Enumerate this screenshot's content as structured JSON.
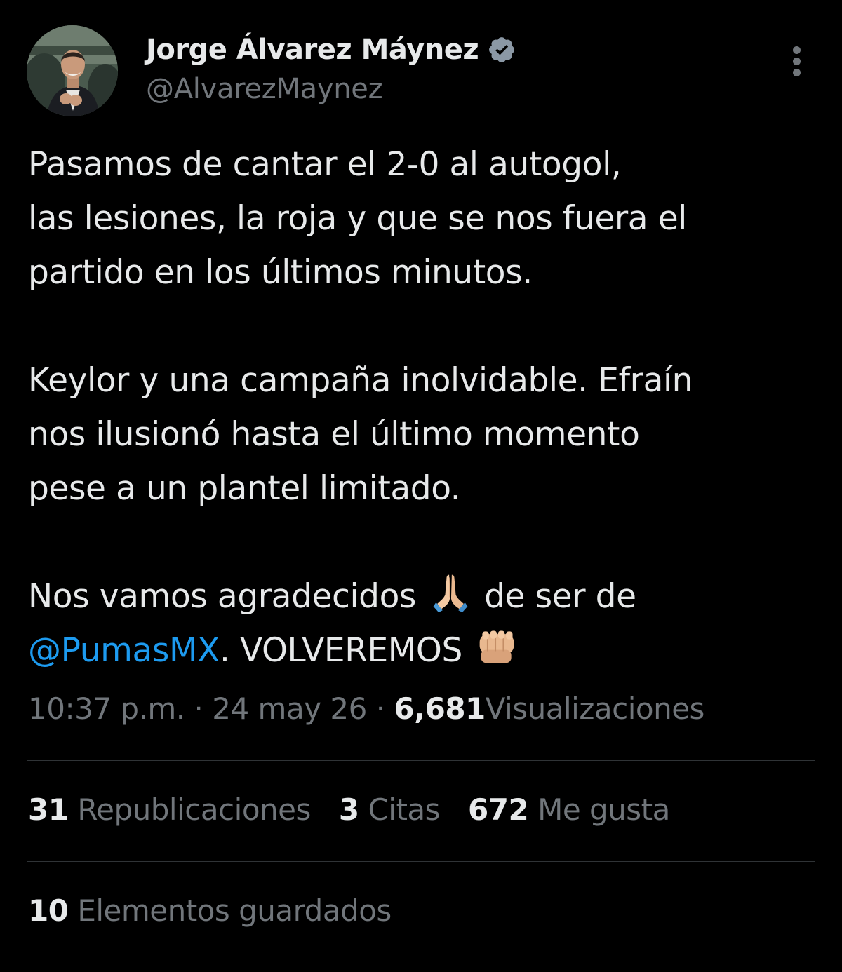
{
  "author": {
    "display_name": "Jorge Álvarez Máynez",
    "handle": "@AlvarezMaynez",
    "verified": true,
    "avatar_icon": "profile-photo"
  },
  "tweet": {
    "lines_p1": [
      "Pasamos de cantar el 2-0 al autogol,",
      "las lesiones, la roja y que se nos fuera el",
      "partido en los últimos minutos."
    ],
    "lines_p2": [
      "Keylor y una campaña inolvidable. Efraín",
      "nos ilusionó hasta el último momento",
      "pese a un plantel limitado."
    ],
    "p3_part1": "Nos vamos agradecidos",
    "p3_part2": "de ser de",
    "mention": "@PumasMX",
    "p3_part3": ". VOLVEREMOS",
    "emoji_1": "folded-hands-icon",
    "emoji_2": "fist-icon"
  },
  "meta": {
    "time": "10:37 p.m.",
    "sep": "·",
    "date": "24 may 26",
    "views_count": "6,681",
    "views_label": "Visualizaciones"
  },
  "stats": {
    "reposts_count": "31",
    "reposts_label": "Republicaciones",
    "quotes_count": "3",
    "quotes_label": "Citas",
    "likes_count": "672",
    "likes_label": "Me gusta"
  },
  "bookmarks": {
    "count": "10",
    "label": "Elementos guardados"
  },
  "colors": {
    "background": "#000000",
    "text": "#e7e9ea",
    "secondary": "#71767b",
    "link": "#1d9bf0",
    "divider": "#2f3336"
  }
}
